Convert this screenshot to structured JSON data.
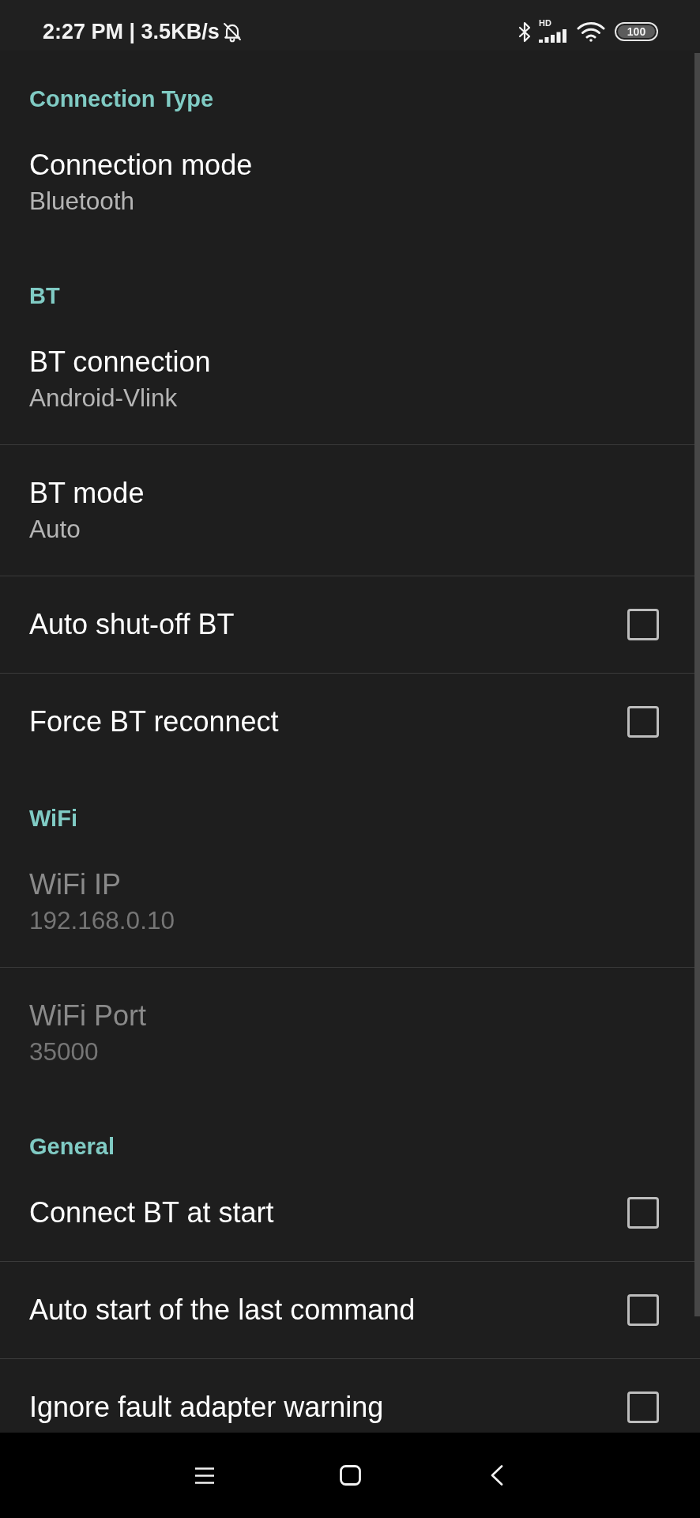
{
  "status_bar": {
    "text": "2:27 PM | 3.5KB/s",
    "network_label": "HD",
    "battery": "100"
  },
  "sections": [
    {
      "title": "Connection Type",
      "items": [
        {
          "kind": "value",
          "title": "Connection mode",
          "summary": "Bluetooth",
          "disabled": false
        }
      ]
    },
    {
      "title": "BT",
      "items": [
        {
          "kind": "value",
          "title": "BT connection",
          "summary": "Android-Vlink",
          "disabled": false
        },
        {
          "kind": "value",
          "title": "BT mode",
          "summary": "Auto",
          "disabled": false
        },
        {
          "kind": "checkbox",
          "title": "Auto shut-off BT",
          "checked": false,
          "disabled": false
        },
        {
          "kind": "checkbox",
          "title": "Force BT reconnect",
          "checked": false,
          "disabled": false
        }
      ]
    },
    {
      "title": "WiFi",
      "items": [
        {
          "kind": "value",
          "title": "WiFi IP",
          "summary": "192.168.0.10",
          "disabled": true
        },
        {
          "kind": "value",
          "title": "WiFi Port",
          "summary": "35000",
          "disabled": true
        }
      ]
    },
    {
      "title": "General",
      "items": [
        {
          "kind": "checkbox",
          "title": "Connect BT at start",
          "checked": false,
          "disabled": false
        },
        {
          "kind": "checkbox",
          "title": "Auto start of the last command",
          "checked": false,
          "disabled": false
        },
        {
          "kind": "checkbox",
          "title": "Ignore fault adapter warning",
          "checked": false,
          "disabled": false
        }
      ]
    }
  ]
}
